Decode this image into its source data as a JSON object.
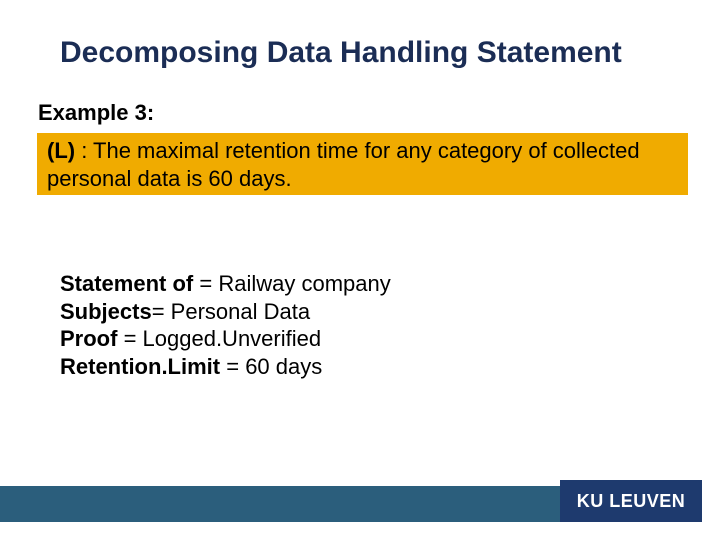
{
  "title": "Decomposing Data Handling Statement",
  "example_label": "Example 3:",
  "highlight": {
    "prefix": "(L)",
    "rest": " : The maximal retention time for any category of collected personal data is 60 days."
  },
  "kv": [
    {
      "key": "Statement of",
      "sep": " = ",
      "value": "Railway company"
    },
    {
      "key": "Subjects",
      "sep": "= ",
      "value": "Personal Data"
    },
    {
      "key": "Proof",
      "sep": " = ",
      "value": "Logged.Unverified"
    },
    {
      "key": "Retention.Limit",
      "sep": " = ",
      "value": "60 days"
    }
  ],
  "footer_brand": "KU LEUVEN"
}
